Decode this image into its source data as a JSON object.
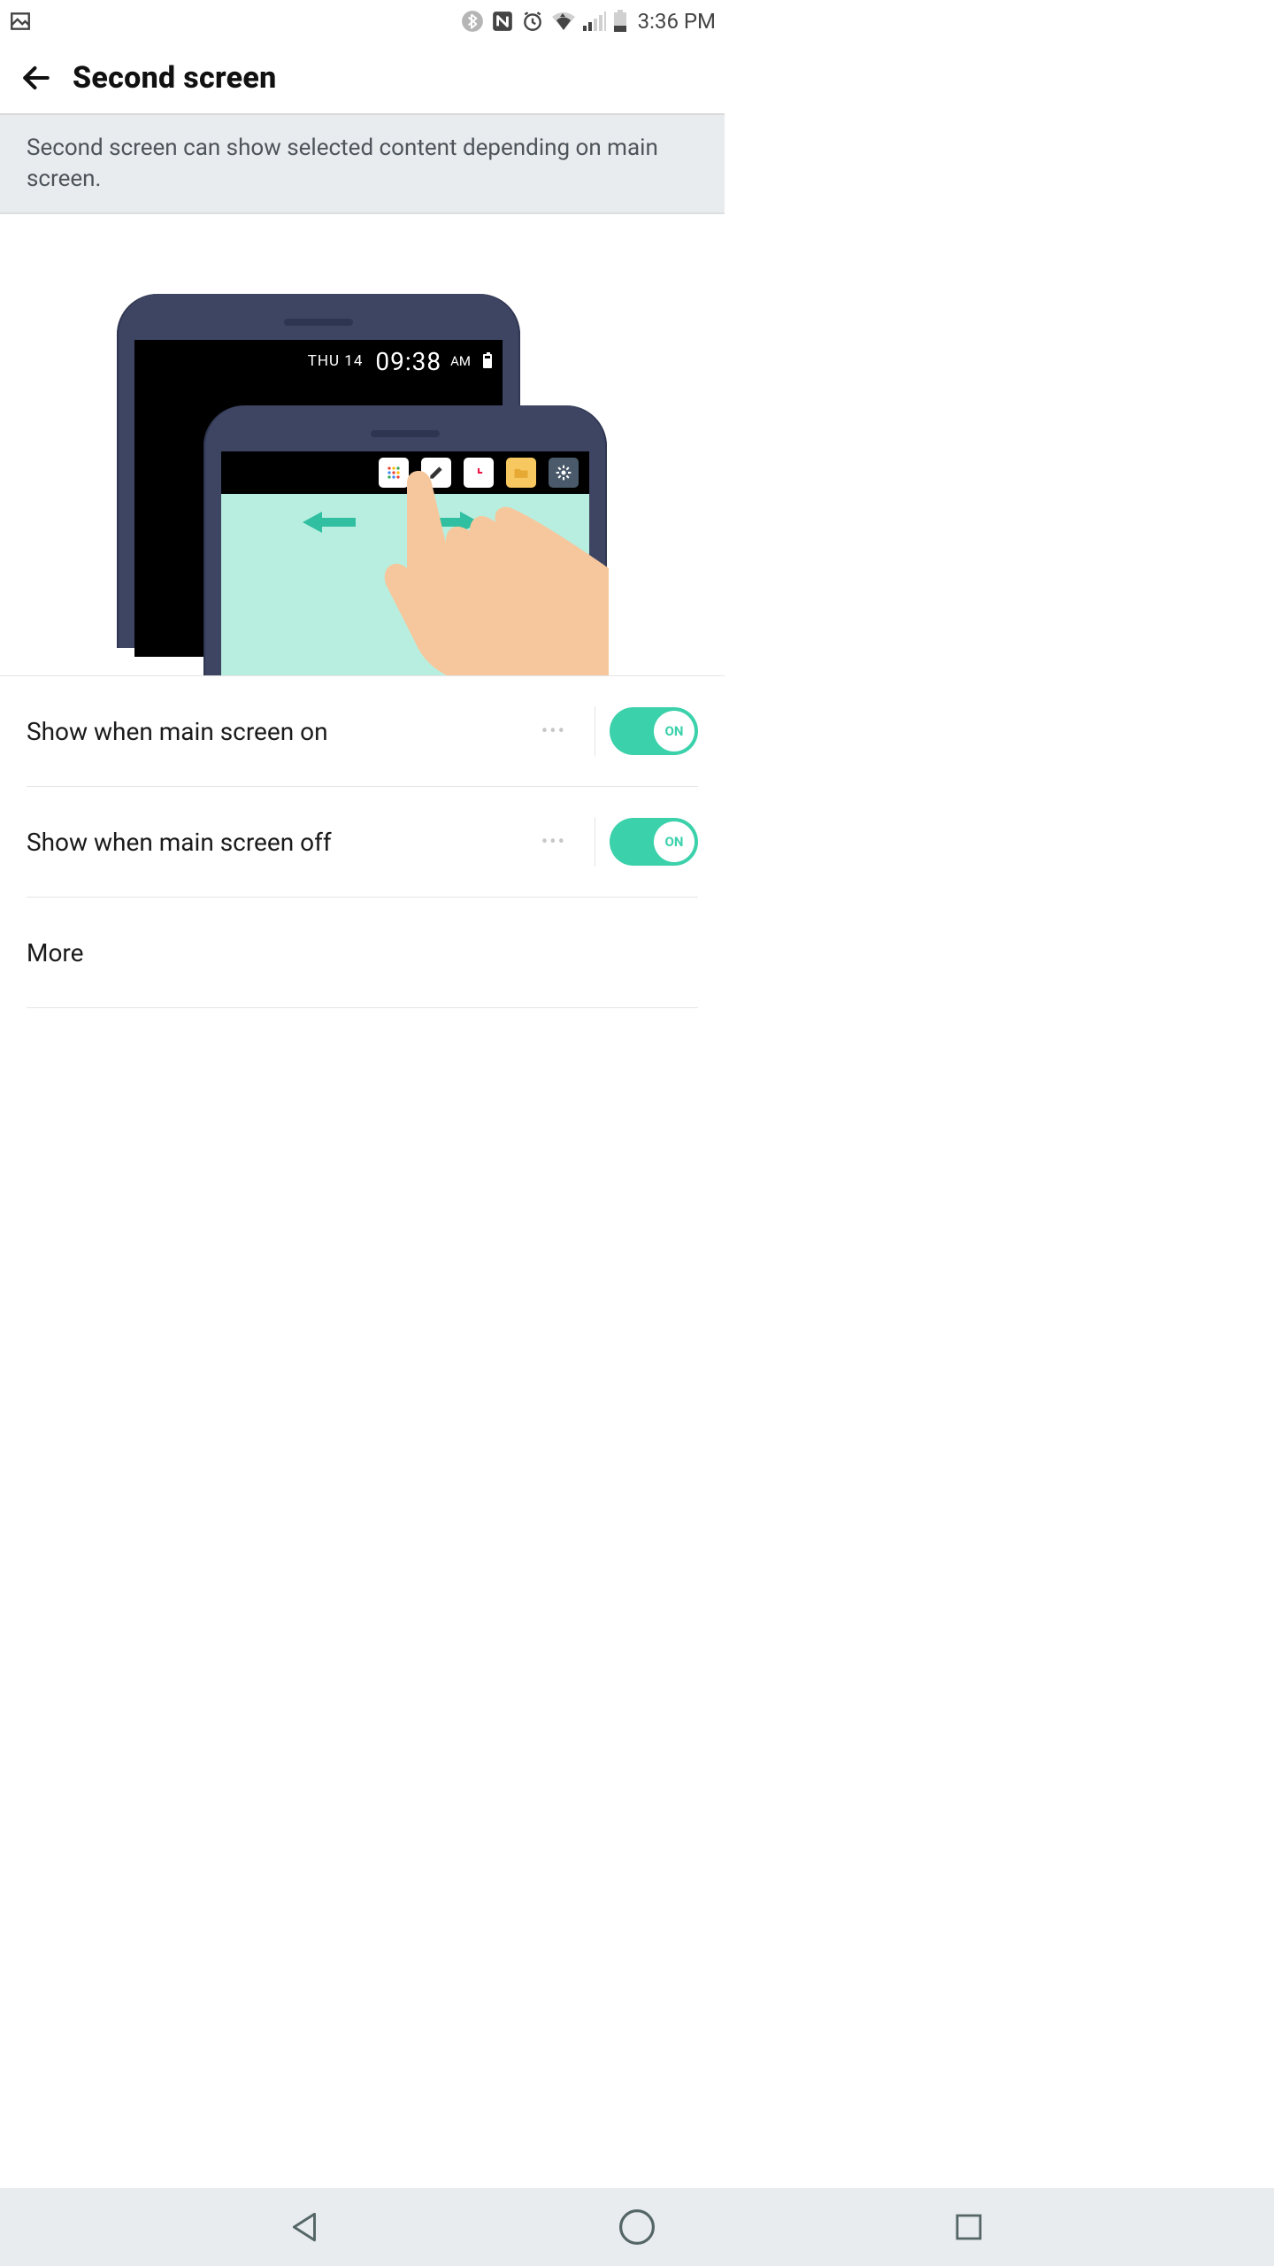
{
  "status": {
    "clock": "3:36 PM"
  },
  "appbar": {
    "title": "Second screen"
  },
  "info": {
    "text": "Second screen can show selected content depending on main screen."
  },
  "illustration": {
    "day": "THU 14",
    "time": "09:38",
    "ampm": "AM"
  },
  "settings": [
    {
      "label": "Show when main screen on",
      "toggle": "ON",
      "has_more": true
    },
    {
      "label": "Show when main screen off",
      "toggle": "ON",
      "has_more": true
    },
    {
      "label": "More",
      "toggle": null,
      "has_more": false
    }
  ]
}
